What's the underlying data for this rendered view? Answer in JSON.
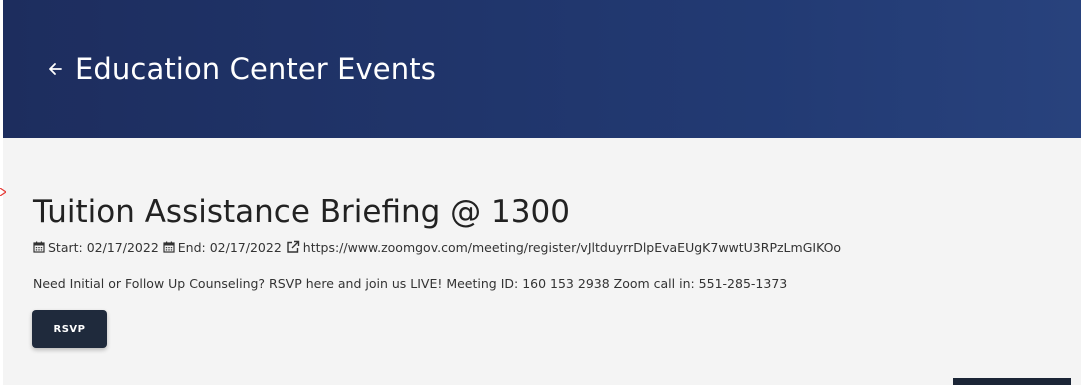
{
  "header": {
    "back_icon": "arrow-left-icon",
    "title": "Education Center Events"
  },
  "event": {
    "title": "Tuition Assistance Briefing @ 1300",
    "start_icon": "calendar-icon",
    "start": "Start: 02/17/2022",
    "end_icon": "calendar-icon",
    "end": "End: 02/17/2022",
    "link_icon": "external-link-icon",
    "link": "https://www.zoomgov.com/meeting/register/vJltduyrrDlpEvaEUgK7wwtU3RPzLmGIKOo",
    "description": "Need Initial or Follow Up Counseling? RSVP here and join us LIVE! Meeting ID: 160 153 2938 Zoom call in: 551-285-1373",
    "rsvp_label": "RSVP"
  },
  "colors": {
    "header_bg": "#1d2d5e",
    "content_bg": "#f4f4f4",
    "button_bg": "#1f2a3c",
    "annotation_arrow": "#e53935"
  }
}
